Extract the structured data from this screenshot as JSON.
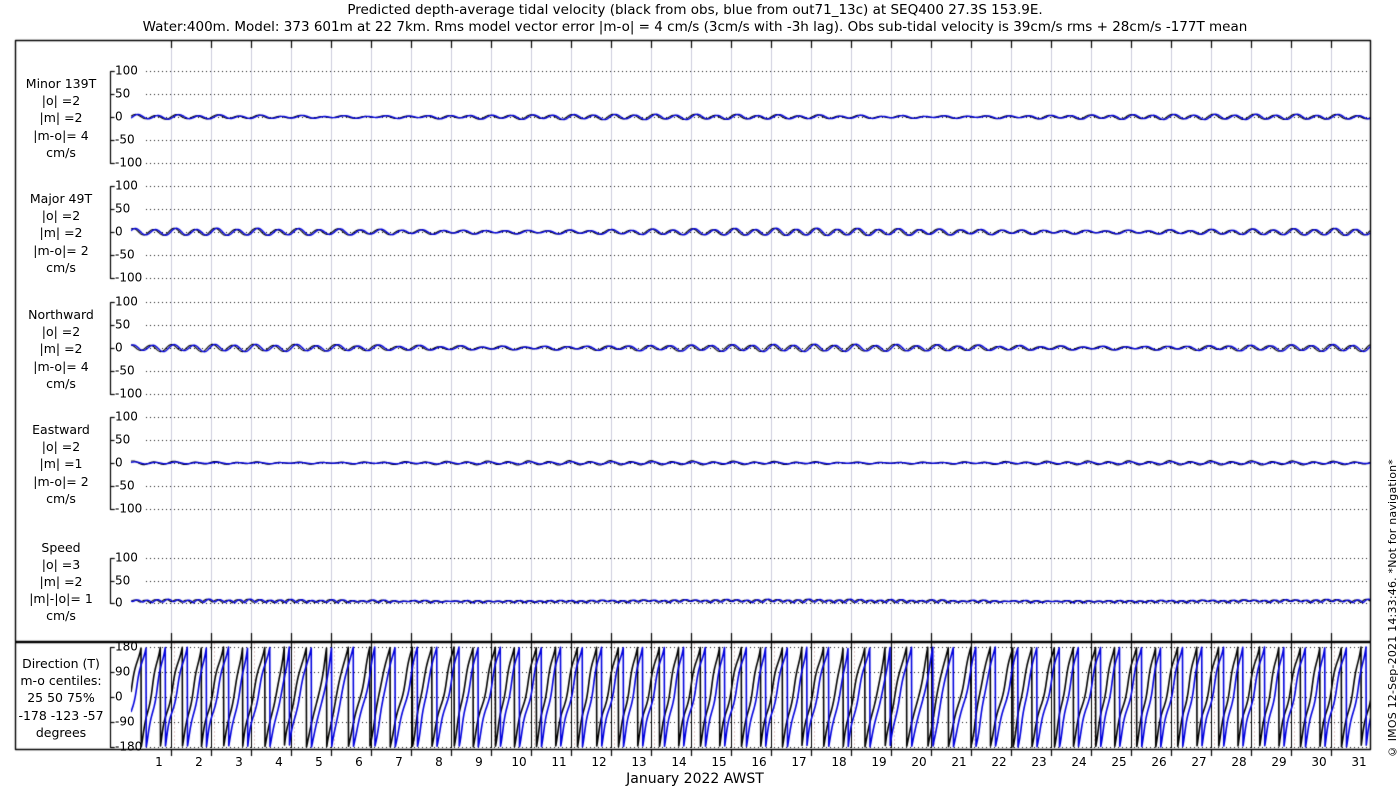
{
  "title_line1": "Predicted depth-average tidal velocity (black from obs, blue from out71_13c) at SEQ400 27.3S 153.9E.",
  "title_line2": "Water:400m. Model: 373 601m at 22 7km. Rms model vector error |m-o| = 4 cm/s (3cm/s with -3h lag). Obs sub-tidal velocity is 39cm/s rms + 28cm/s -177T mean",
  "watermark": "© IMOS 12-Sep-2021 14:33:46. *Not for navigation*",
  "colors": {
    "obs": "#000000",
    "model": "#0000dd",
    "day_grid_velocity": "#ccccdd",
    "day_grid_direction": "#000000",
    "day_grid_minor_pink": "#e4c9c9",
    "dotted_grid": "#111111",
    "frame": "#000000"
  },
  "chart_data": {
    "type": "line",
    "title": "Predicted depth-average tidal velocity (black from obs, blue from out71_13c) at SEQ400 27.3S 153.9E.",
    "subtitle": "Water:400m. Model: 373 601m at 22 7km. Rms model vector error |m-o| = 4 cm/s (3cm/s with -3h lag). Obs sub-tidal velocity is 39cm/s rms + 28cm/s -177T mean",
    "xaxis": {
      "label": "January 2022 AWST",
      "units": "days",
      "range_days": [
        0,
        31
      ],
      "day_tick_labels": [
        1,
        2,
        3,
        4,
        5,
        6,
        7,
        8,
        9,
        10,
        11,
        12,
        13,
        14,
        15,
        16,
        17,
        18,
        19,
        20,
        21,
        22,
        23,
        24,
        25,
        26,
        27,
        28,
        29,
        30,
        31
      ],
      "grid": true
    },
    "legend": {
      "obs": "black from obs",
      "model": "blue from out71_13c"
    },
    "panels": [
      {
        "name": "minor",
        "label_lines": [
          "Minor 139T",
          "|o| =2",
          "|m| =2",
          "|m-o|= 4",
          "cm/s"
        ],
        "unit": "cm/s",
        "ylim": [
          -100,
          100
        ],
        "yticks": [
          100,
          50,
          0,
          -50,
          -100
        ],
        "stats": {
          "rms_obs": 2,
          "rms_model": 2,
          "rms_diff": 4
        },
        "series": [
          {
            "name": "obs",
            "color_key": "obs"
          },
          {
            "name": "model",
            "color_key": "model"
          }
        ],
        "approx": {
          "kind": "sum_of_sines",
          "amps_obs": [
            3.5,
            1.5,
            1.2
          ],
          "phases_obs": [
            0.0,
            0.8,
            0.3
          ],
          "model_amp_factor": 1.0,
          "model_lag_days": 0.06
        }
      },
      {
        "name": "major",
        "label_lines": [
          "Major 49T",
          "|o| =2",
          "|m| =2",
          "|m-o|= 2",
          "cm/s"
        ],
        "unit": "cm/s",
        "ylim": [
          -100,
          100
        ],
        "yticks": [
          100,
          50,
          0,
          -50,
          -100
        ],
        "stats": {
          "rms_obs": 2,
          "rms_model": 2,
          "rms_diff": 2
        },
        "series": [
          {
            "name": "obs",
            "color_key": "obs"
          },
          {
            "name": "model",
            "color_key": "model"
          }
        ],
        "approx": {
          "kind": "sum_of_sines",
          "amps_obs": [
            5.0,
            2.0,
            1.3
          ],
          "phases_obs": [
            1.2,
            0.3,
            1.0
          ],
          "model_amp_factor": 1.0,
          "model_lag_days": 0.055
        }
      },
      {
        "name": "northward",
        "label_lines": [
          "Northward",
          "|o| =2",
          "|m| =2",
          "|m-o|= 4",
          "cm/s"
        ],
        "unit": "cm/s",
        "ylim": [
          -100,
          100
        ],
        "yticks": [
          100,
          50,
          0,
          -50,
          -100
        ],
        "stats": {
          "rms_obs": 2,
          "rms_model": 2,
          "rms_diff": 4
        },
        "series": [
          {
            "name": "obs",
            "color_key": "obs"
          },
          {
            "name": "model",
            "color_key": "model"
          }
        ],
        "approx": {
          "kind": "sum_of_sines",
          "amps_obs": [
            5.0,
            2.0,
            1.4
          ],
          "phases_obs": [
            2.1,
            1.1,
            0.5
          ],
          "model_amp_factor": 1.0,
          "model_lag_days": 0.065
        }
      },
      {
        "name": "eastward",
        "label_lines": [
          "Eastward",
          "|o| =2",
          "|m| =1",
          "|m-o|= 2",
          "cm/s"
        ],
        "unit": "cm/s",
        "ylim": [
          -100,
          100
        ],
        "yticks": [
          100,
          50,
          0,
          -50,
          -100
        ],
        "stats": {
          "rms_obs": 2,
          "rms_model": 1,
          "rms_diff": 2
        },
        "series": [
          {
            "name": "obs",
            "color_key": "obs"
          },
          {
            "name": "model",
            "color_key": "model"
          }
        ],
        "approx": {
          "kind": "sum_of_sines",
          "amps_obs": [
            3.0,
            1.3,
            0.9
          ],
          "phases_obs": [
            0.6,
            1.9,
            1.4
          ],
          "model_amp_factor": 0.55,
          "model_lag_days": 0.05
        }
      },
      {
        "name": "speed",
        "label_lines": [
          "Speed",
          "|o| =3",
          "|m| =2",
          "|m|-|o|= 1",
          "cm/s"
        ],
        "unit": "cm/s",
        "ylim": [
          0,
          100
        ],
        "yticks": [
          100,
          50,
          0
        ],
        "stats": {
          "rms_obs": 3,
          "rms_model": 2,
          "rms_abs_diff": 1
        },
        "series": [
          {
            "name": "obs",
            "color_key": "obs"
          },
          {
            "name": "model",
            "color_key": "model"
          }
        ],
        "approx": {
          "kind": "speed_from_uv",
          "uv": {
            "amps_u": [
              3.0,
              1.3,
              0.9
            ],
            "phases_u": [
              0.6,
              1.9,
              1.4
            ],
            "amps_v": [
              5.0,
              2.0,
              1.4
            ],
            "phases_v": [
              2.1,
              1.1,
              0.5
            ]
          },
          "model_lag_days": 0.06
        }
      },
      {
        "name": "direction",
        "label_lines": [
          "Direction (T)",
          "m-o centiles:",
          "25 50 75%",
          "-178 -123 -57",
          "degrees"
        ],
        "unit": "degrees",
        "ylim": [
          -180,
          180
        ],
        "yticks": [
          180,
          90,
          0,
          -90,
          -180
        ],
        "stats": {
          "mo_centiles_pct": [
            25,
            50,
            75
          ],
          "mo_centiles_deg": [
            -178,
            -123,
            -57
          ]
        },
        "series": [
          {
            "name": "obs",
            "color_key": "obs"
          },
          {
            "name": "model",
            "color_key": "model"
          }
        ],
        "approx": {
          "kind": "direction_from_uv",
          "uv": {
            "amps_u": [
              5.0,
              2.0,
              1.4
            ],
            "phases_u": [
              0.0,
              0.8,
              0.3
            ],
            "amps_v": [
              5.0,
              2.0,
              1.4
            ],
            "phases_v": [
              0.3,
              1.5,
              0.9
            ]
          },
          "model_lag_days": 0.125
        }
      }
    ],
    "periods_days": {
      "semidiurnal_m2": 0.5175,
      "semidiurnal_s2": 0.5,
      "diurnal_k1": 0.9973
    }
  }
}
